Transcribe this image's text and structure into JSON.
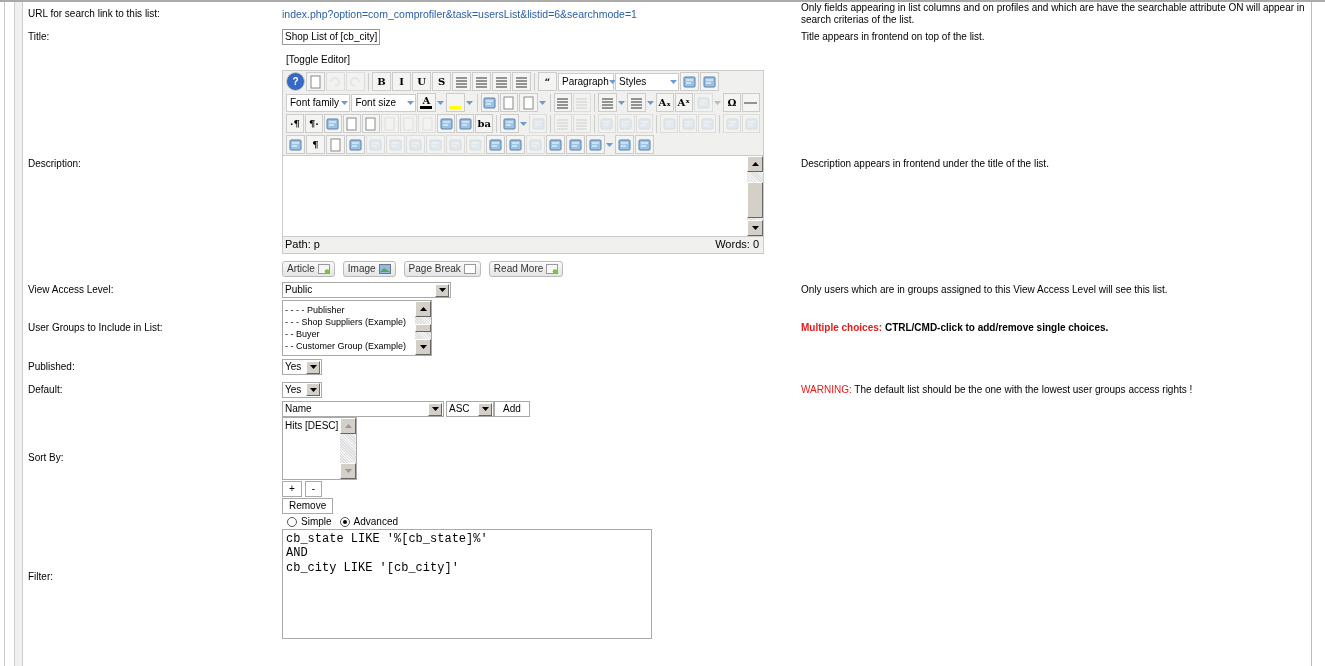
{
  "url_row": {
    "label": "URL for search link to this list:",
    "value": "index.php?option=com_comprofiler&task=usersList&listid=6&searchmode=1",
    "description": "Only fields appearing in list columns and on profiles and which are have the searchable attribute ON will appear in search criterias of the list."
  },
  "title_row": {
    "label": "Title:",
    "value": "Shop List of [cb_city]",
    "description": "Title appears in frontend on top of the list."
  },
  "description_row": {
    "label": "Description:",
    "toggle": "[Toggle Editor]",
    "description": "Description appears in frontend under the title of the list.",
    "path": "Path: p",
    "words": "Words: 0",
    "toolbar": [
      [
        {
          "kind": "help",
          "glyph": "?",
          "disabled": false
        },
        {
          "kind": "page",
          "disabled": false
        },
        {
          "kind": "undo",
          "disabled": true
        },
        {
          "kind": "redo",
          "disabled": true
        },
        {
          "kind": "sep"
        },
        {
          "kind": "glyph",
          "glyph": "B",
          "disabled": false
        },
        {
          "kind": "glyph",
          "glyph": "I",
          "disabled": false
        },
        {
          "kind": "glyph",
          "glyph": "U",
          "disabled": false
        },
        {
          "kind": "glyph",
          "glyph": "S",
          "disabled": false
        },
        {
          "kind": "lines",
          "disabled": false
        },
        {
          "kind": "lines",
          "disabled": false
        },
        {
          "kind": "lines",
          "disabled": false
        },
        {
          "kind": "lines",
          "disabled": false
        },
        {
          "kind": "sep"
        },
        {
          "kind": "glyph",
          "glyph": "“",
          "disabled": false
        },
        {
          "kind": "dropdown",
          "label": "Paragraph"
        },
        {
          "kind": "dropdown",
          "label": "Styles"
        },
        {
          "kind": "tool",
          "disabled": false
        },
        {
          "kind": "tool",
          "disabled": false
        }
      ],
      [
        {
          "kind": "dropdown",
          "label": "Font family"
        },
        {
          "kind": "dropdown",
          "label": "Font size"
        },
        {
          "kind": "color",
          "glyph": "A",
          "color": "#000000",
          "disabled": false
        },
        {
          "kind": "color",
          "color": "#ffff00",
          "disabled": false
        },
        {
          "kind": "sep"
        },
        {
          "kind": "tool",
          "disabled": false
        },
        {
          "kind": "page",
          "disabled": false
        },
        {
          "kind": "page",
          "split": true,
          "disabled": false
        },
        {
          "kind": "sep"
        },
        {
          "kind": "lines",
          "disabled": false
        },
        {
          "kind": "lines",
          "disabled": true
        },
        {
          "kind": "sep"
        },
        {
          "kind": "lines",
          "split": true,
          "disabled": false
        },
        {
          "kind": "lines",
          "split": true,
          "disabled": false
        },
        {
          "kind": "glyph",
          "glyph": "Aₓ",
          "disabled": false
        },
        {
          "kind": "glyph",
          "glyph": "Aˣ",
          "disabled": false
        },
        {
          "kind": "tool",
          "split": true,
          "disabled": true
        },
        {
          "kind": "glyph",
          "glyph": "Ω",
          "disabled": false
        },
        {
          "kind": "rule",
          "disabled": false
        }
      ],
      [
        {
          "kind": "glyph",
          "glyph": "·¶",
          "disabled": false
        },
        {
          "kind": "glyph",
          "glyph": "¶·",
          "disabled": false
        },
        {
          "kind": "tool",
          "disabled": false
        },
        {
          "kind": "page",
          "disabled": false
        },
        {
          "kind": "page",
          "disabled": false
        },
        {
          "kind": "page",
          "disabled": true
        },
        {
          "kind": "page",
          "disabled": true
        },
        {
          "kind": "page",
          "disabled": true
        },
        {
          "kind": "tool",
          "disabled": false
        },
        {
          "kind": "tool",
          "disabled": false
        },
        {
          "kind": "glyph",
          "glyph": "ba",
          "disabled": false
        },
        {
          "kind": "sep"
        },
        {
          "kind": "tool",
          "split": true,
          "disabled": false
        },
        {
          "kind": "tool",
          "disabled": true
        },
        {
          "kind": "sep"
        },
        {
          "kind": "lines",
          "disabled": true
        },
        {
          "kind": "lines",
          "disabled": true
        },
        {
          "kind": "sep"
        },
        {
          "kind": "tool",
          "disabled": true
        },
        {
          "kind": "tool",
          "disabled": true
        },
        {
          "kind": "tool",
          "disabled": true
        },
        {
          "kind": "sep"
        },
        {
          "kind": "tool",
          "disabled": true
        },
        {
          "kind": "tool",
          "disabled": true
        },
        {
          "kind": "tool",
          "disabled": true
        },
        {
          "kind": "sep"
        },
        {
          "kind": "tool",
          "disabled": true
        },
        {
          "kind": "tool",
          "disabled": true
        }
      ],
      [
        {
          "kind": "tool",
          "disabled": false
        },
        {
          "kind": "glyph",
          "glyph": "¶",
          "disabled": false
        },
        {
          "kind": "page",
          "disabled": false
        },
        {
          "kind": "tool",
          "disabled": false
        },
        {
          "kind": "tool",
          "disabled": true
        },
        {
          "kind": "tool",
          "disabled": true
        },
        {
          "kind": "tool",
          "disabled": true
        },
        {
          "kind": "tool",
          "disabled": true
        },
        {
          "kind": "tool",
          "disabled": true
        },
        {
          "kind": "tool",
          "disabled": true
        },
        {
          "kind": "tool",
          "disabled": false
        },
        {
          "kind": "tool",
          "disabled": false
        },
        {
          "kind": "tool",
          "disabled": true
        },
        {
          "kind": "tool",
          "disabled": false
        },
        {
          "kind": "tool",
          "disabled": false
        },
        {
          "kind": "tool",
          "split": true,
          "disabled": false
        },
        {
          "kind": "tool",
          "disabled": false
        },
        {
          "kind": "tool",
          "disabled": false
        }
      ]
    ],
    "insert_buttons": [
      {
        "label": "Article",
        "kind": "page"
      },
      {
        "label": "Image",
        "kind": "image"
      },
      {
        "label": "Page Break",
        "kind": "blank"
      },
      {
        "label": "Read More",
        "kind": "page"
      }
    ]
  },
  "view_access": {
    "label": "View Access Level:",
    "value": "Public",
    "description": "Only users which are in groups assigned to this View Access Level will see this list."
  },
  "user_groups": {
    "label": "User Groups to Include in List:",
    "options": [
      {
        "label": "- - - - Publisher",
        "selected": false
      },
      {
        "label": "- - - Shop Suppliers (Example)",
        "selected": false
      },
      {
        "label": "- - Buyer",
        "selected": false
      },
      {
        "label": "- - Customer Group (Example)",
        "selected": false
      }
    ],
    "description_lead": "Multiple choices:",
    "description": "CTRL/CMD-click to add/remove single choices."
  },
  "published": {
    "label": "Published:",
    "value": "Yes"
  },
  "default": {
    "label": "Default:",
    "value": "Yes",
    "warning_lead": "WARNING:",
    "description": "The default list should be the one with the lowest user groups access rights !"
  },
  "sort_by": {
    "label": "Sort By:",
    "field": "Name",
    "direction": "ASC",
    "add": "Add",
    "items": [
      "Hits [DESC]"
    ],
    "plus": "+",
    "minus": "-",
    "remove": "Remove"
  },
  "filter": {
    "label": "Filter:",
    "modes": [
      {
        "label": "Simple",
        "selected": false
      },
      {
        "label": "Advanced",
        "selected": true
      }
    ],
    "value": "cb_state LIKE '%[cb_state]%'\nAND\ncb_city LIKE '[cb_city]'"
  }
}
